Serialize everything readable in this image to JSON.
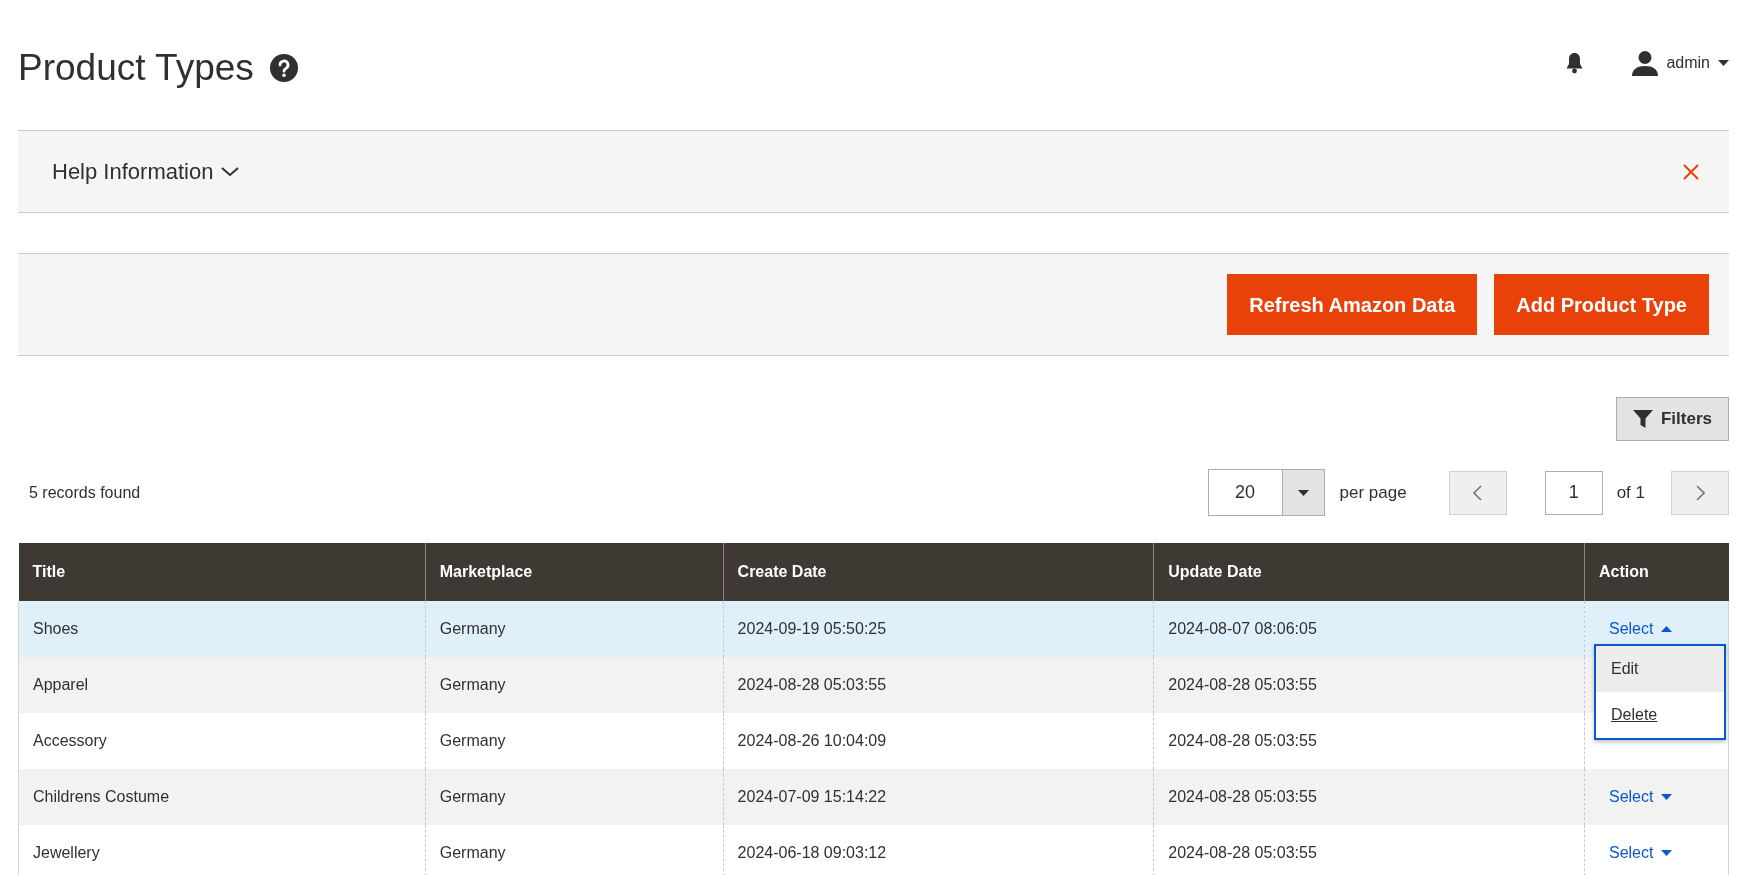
{
  "page": {
    "title": "Product Types"
  },
  "header": {
    "user": "admin"
  },
  "help_panel": {
    "title": "Help Information",
    "expanded": false
  },
  "actions": [
    "Refresh Amazon Data",
    "Add Product Type"
  ],
  "filters_button": "Filters",
  "records_found": "5 records found",
  "pagination": {
    "per_page": "20",
    "per_page_label": "per page",
    "page": "1",
    "of_pages": "of 1"
  },
  "table": {
    "columns": [
      "Title",
      "Marketplace",
      "Create Date",
      "Update Date",
      "Action"
    ],
    "rows": [
      {
        "title": "Shoes",
        "marketplace": "Germany",
        "create_date": "2024-09-19 05:50:25",
        "update_date": "2024-08-07 08:06:05",
        "selected": true,
        "action": {
          "label": "Select",
          "open": true
        }
      },
      {
        "title": "Apparel",
        "marketplace": "Germany",
        "create_date": "2024-08-28 05:03:55",
        "update_date": "2024-08-28 05:03:55",
        "selected": false
      },
      {
        "title": "Accessory",
        "marketplace": "Germany",
        "create_date": "2024-08-26 10:04:09",
        "update_date": "2024-08-28 05:03:55",
        "selected": false
      },
      {
        "title": "Childrens Costume",
        "marketplace": "Germany",
        "create_date": "2024-07-09 15:14:22",
        "update_date": "2024-08-28 05:03:55",
        "selected": false,
        "action": {
          "label": "Select",
          "open": false
        }
      },
      {
        "title": "Jewellery",
        "marketplace": "Germany",
        "create_date": "2024-06-18 09:03:12",
        "update_date": "2024-08-28 05:03:55",
        "selected": false,
        "action": {
          "label": "Select",
          "open": false
        }
      }
    ]
  },
  "action_menu": {
    "items": [
      {
        "label": "Edit",
        "hovered": true
      },
      {
        "label": "Delete",
        "hovered": false
      }
    ]
  }
}
